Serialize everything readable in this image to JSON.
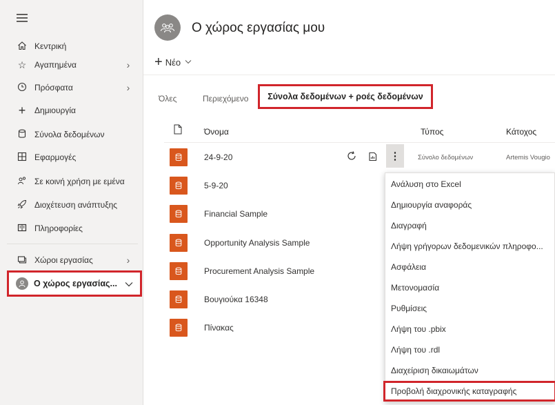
{
  "sidebar": {
    "items": [
      {
        "icon": "home-icon",
        "label": "Κεντρική",
        "chevron": false
      },
      {
        "icon": "star-icon",
        "label": "Αγαπημένα",
        "chevron": true
      },
      {
        "icon": "clock-icon",
        "label": "Πρόσφατα",
        "chevron": true
      },
      {
        "icon": "plus-icon",
        "label": "Δημιουργία",
        "chevron": false
      },
      {
        "icon": "database-icon",
        "label": "Σύνολα δεδομένων",
        "chevron": false
      },
      {
        "icon": "apps-icon",
        "label": "Εφαρμογές",
        "chevron": false
      },
      {
        "icon": "shared-icon",
        "label": "Σε κοινή χρήση με εμένα",
        "chevron": false
      },
      {
        "icon": "rocket-icon",
        "label": "Διοχέτευση ανάπτυξης",
        "chevron": false
      },
      {
        "icon": "book-icon",
        "label": "Πληροφορίες",
        "chevron": false
      },
      {
        "icon": "workspaces-icon",
        "label": "Χώροι εργασίας",
        "chevron": true
      }
    ],
    "current_workspace": "Ο χώρος εργασίας..."
  },
  "header": {
    "title": "Ο χώρος εργασίας μου",
    "new_label": "Νέο"
  },
  "tabs": {
    "all": "Όλες",
    "content": "Περιεχόμενο",
    "datasets": "Σύνολα δεδομένων + ροές δεδομένων"
  },
  "table": {
    "columns": {
      "name": "Όνομα",
      "type": "Τύπος",
      "owner": "Κάτοχος"
    },
    "rows": [
      {
        "name": "24-9-20",
        "type": "Σύνολο δεδομένων",
        "owner": "Artemis Vougio"
      },
      {
        "name": "5-9-20"
      },
      {
        "name": "Financial Sample"
      },
      {
        "name": "Opportunity Analysis Sample"
      },
      {
        "name": "Procurement Analysis Sample"
      },
      {
        "name": "Βουγιούκα 16348"
      },
      {
        "name": "Πίνακας"
      }
    ]
  },
  "context_menu": {
    "items": [
      "Ανάλυση στο Excel",
      "Δημιουργία αναφοράς",
      "Διαγραφή",
      "Λήψη γρήγορων δεδομενικών πληροφο...",
      "Ασφάλεια",
      "Μετονομασία",
      "Ρυθμίσεις",
      "Λήψη του .pbix",
      "Λήψη του .rdl",
      "Διαχείριση δικαιωμάτων",
      "Προβολή διαχρονικής καταγραφής"
    ]
  },
  "colors": {
    "accent_highlight": "#d1252b",
    "dataset_icon": "#d9571d",
    "sidebar_bg": "#f3f2f1"
  }
}
